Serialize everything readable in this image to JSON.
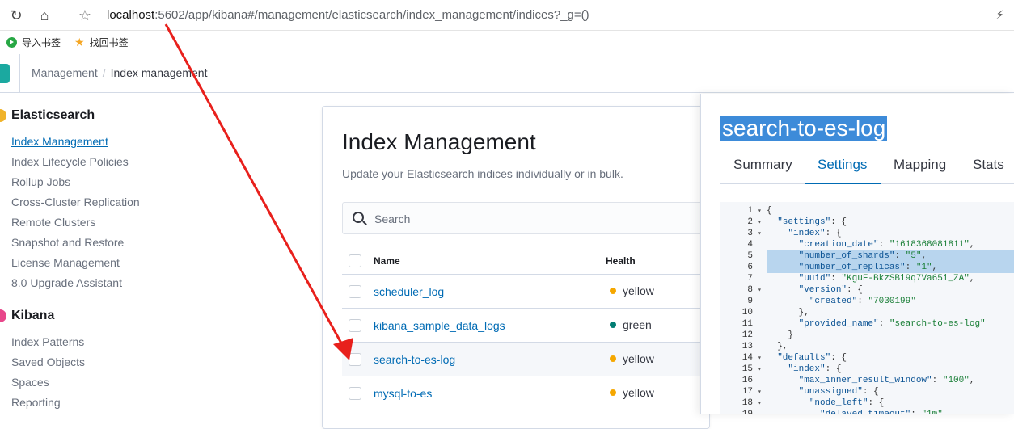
{
  "browser": {
    "url_host": "localhost",
    "url_rest": ":5602/app/kibana#/management/elasticsearch/index_management/indices?_g=()",
    "bookmarks": [
      "导入书签",
      "找回书签"
    ]
  },
  "header": {
    "breadcrumb_1": "Management",
    "breadcrumb_sep": "/",
    "breadcrumb_2": "Index management"
  },
  "sidebar": {
    "elasticsearch": {
      "title": "Elasticsearch",
      "items": [
        "Index Management",
        "Index Lifecycle Policies",
        "Rollup Jobs",
        "Cross-Cluster Replication",
        "Remote Clusters",
        "Snapshot and Restore",
        "License Management",
        "8.0 Upgrade Assistant"
      ]
    },
    "kibana": {
      "title": "Kibana",
      "items": [
        "Index Patterns",
        "Saved Objects",
        "Spaces",
        "Reporting"
      ]
    }
  },
  "main": {
    "title": "Index Management",
    "subtitle": "Update your Elasticsearch indices individually or in bulk.",
    "search_placeholder": "Search",
    "columns": [
      "Name",
      "Health"
    ],
    "rows": [
      {
        "name": "scheduler_log",
        "health": "yellow",
        "color": "#f5a700"
      },
      {
        "name": "kibana_sample_data_logs",
        "health": "green",
        "color": "#017d73"
      },
      {
        "name": "search-to-es-log",
        "health": "yellow",
        "color": "#f5a700"
      },
      {
        "name": "mysql-to-es",
        "health": "yellow",
        "color": "#f5a700"
      }
    ]
  },
  "flyout": {
    "title": "search-to-es-log",
    "tabs": [
      "Summary",
      "Settings",
      "Mapping",
      "Stats"
    ],
    "code_lines": [
      "{",
      "  \"settings\": {",
      "    \"index\": {",
      "      \"creation_date\": \"1618368081811\",",
      "      \"number_of_shards\": \"5\",",
      "      \"number_of_replicas\": \"1\",",
      "      \"uuid\": \"KguF-BkzSBi9q7Va65i_ZA\",",
      "      \"version\": {",
      "        \"created\": \"7030199\"",
      "      },",
      "      \"provided_name\": \"search-to-es-log\"",
      "    }",
      "  },",
      "  \"defaults\": {",
      "    \"index\": {",
      "      \"max_inner_result_window\": \"100\",",
      "      \"unassigned\": {",
      "        \"node_left\": {",
      "          \"delayed_timeout\": \"1m\""
    ]
  }
}
